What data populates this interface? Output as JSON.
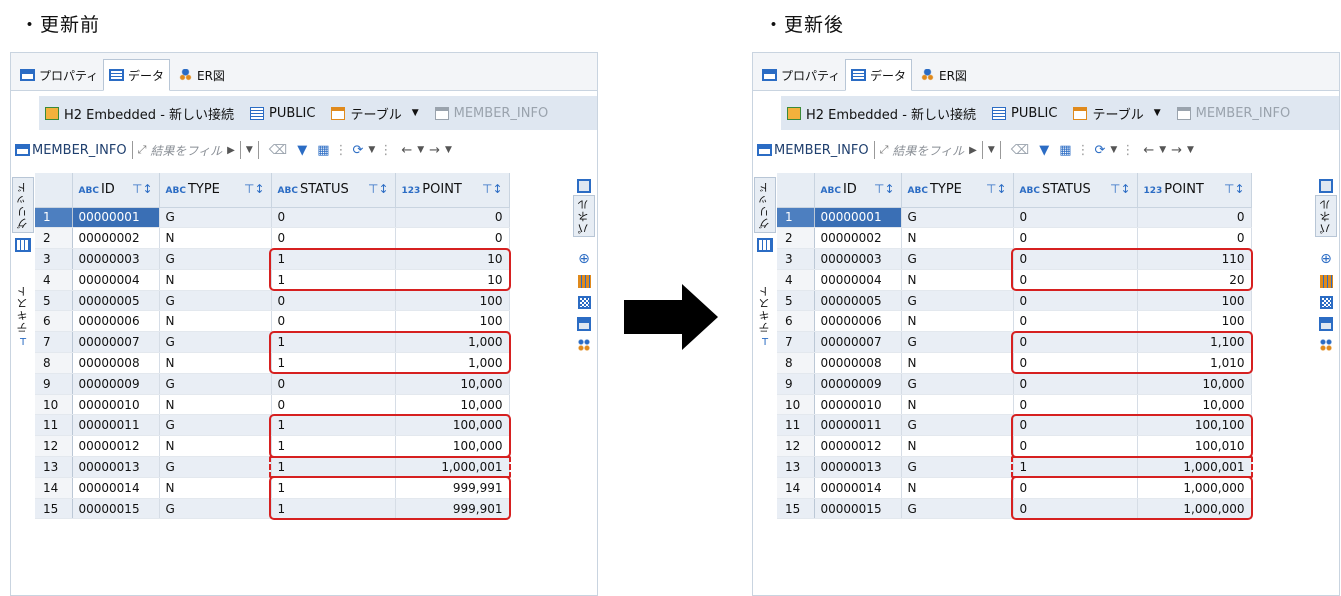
{
  "headings": {
    "before": "・更新前",
    "after": "・更新後"
  },
  "tabs": [
    {
      "label": "プロパティ",
      "icon": "properties-icon"
    },
    {
      "label": "データ",
      "icon": "data-icon"
    },
    {
      "label": "ER図",
      "icon": "er-diagram-icon"
    }
  ],
  "breadcrumb": {
    "connection": "H2 Embedded - 新しい接続",
    "schema": "PUBLIC",
    "tables": "テーブル",
    "table": "MEMBER_INFO"
  },
  "toolbar": {
    "table_name": "MEMBER_INFO",
    "filter_placeholder": "結果をフィル"
  },
  "side_tabs": {
    "grid": "グリッド",
    "text": "テキスト",
    "panel": "パネル"
  },
  "columns": [
    {
      "type": "ABC",
      "name": "ID"
    },
    {
      "type": "ABC",
      "name": "TYPE"
    },
    {
      "type": "ABC",
      "name": "STATUS"
    },
    {
      "type": "123",
      "name": "POINT"
    }
  ],
  "before_rows": [
    [
      "1",
      "00000001",
      "G",
      "0",
      "0"
    ],
    [
      "2",
      "00000002",
      "N",
      "0",
      "0"
    ],
    [
      "3",
      "00000003",
      "G",
      "1",
      "10"
    ],
    [
      "4",
      "00000004",
      "N",
      "1",
      "10"
    ],
    [
      "5",
      "00000005",
      "G",
      "0",
      "100"
    ],
    [
      "6",
      "00000006",
      "N",
      "0",
      "100"
    ],
    [
      "7",
      "00000007",
      "G",
      "1",
      "1,000"
    ],
    [
      "8",
      "00000008",
      "N",
      "1",
      "1,000"
    ],
    [
      "9",
      "00000009",
      "G",
      "0",
      "10,000"
    ],
    [
      "10",
      "00000010",
      "N",
      "0",
      "10,000"
    ],
    [
      "11",
      "00000011",
      "G",
      "1",
      "100,000"
    ],
    [
      "12",
      "00000012",
      "N",
      "1",
      "100,000"
    ],
    [
      "13",
      "00000013",
      "G",
      "1",
      "1,000,001"
    ],
    [
      "14",
      "00000014",
      "N",
      "1",
      "999,991"
    ],
    [
      "15",
      "00000015",
      "G",
      "1",
      "999,901"
    ]
  ],
  "after_rows": [
    [
      "1",
      "00000001",
      "G",
      "0",
      "0"
    ],
    [
      "2",
      "00000002",
      "N",
      "0",
      "0"
    ],
    [
      "3",
      "00000003",
      "G",
      "0",
      "110"
    ],
    [
      "4",
      "00000004",
      "N",
      "0",
      "20"
    ],
    [
      "5",
      "00000005",
      "G",
      "0",
      "100"
    ],
    [
      "6",
      "00000006",
      "N",
      "0",
      "100"
    ],
    [
      "7",
      "00000007",
      "G",
      "0",
      "1,100"
    ],
    [
      "8",
      "00000008",
      "N",
      "0",
      "1,010"
    ],
    [
      "9",
      "00000009",
      "G",
      "0",
      "10,000"
    ],
    [
      "10",
      "00000010",
      "N",
      "0",
      "10,000"
    ],
    [
      "11",
      "00000011",
      "G",
      "0",
      "100,100"
    ],
    [
      "12",
      "00000012",
      "N",
      "0",
      "100,010"
    ],
    [
      "13",
      "00000013",
      "G",
      "1",
      "1,000,001"
    ],
    [
      "14",
      "00000014",
      "N",
      "0",
      "1,000,000"
    ],
    [
      "15",
      "00000015",
      "G",
      "0",
      "1,000,000"
    ]
  ],
  "colors": {
    "highlight": "#d62020",
    "selected": "#3a6fb5",
    "accent": "#2b6cc4"
  }
}
